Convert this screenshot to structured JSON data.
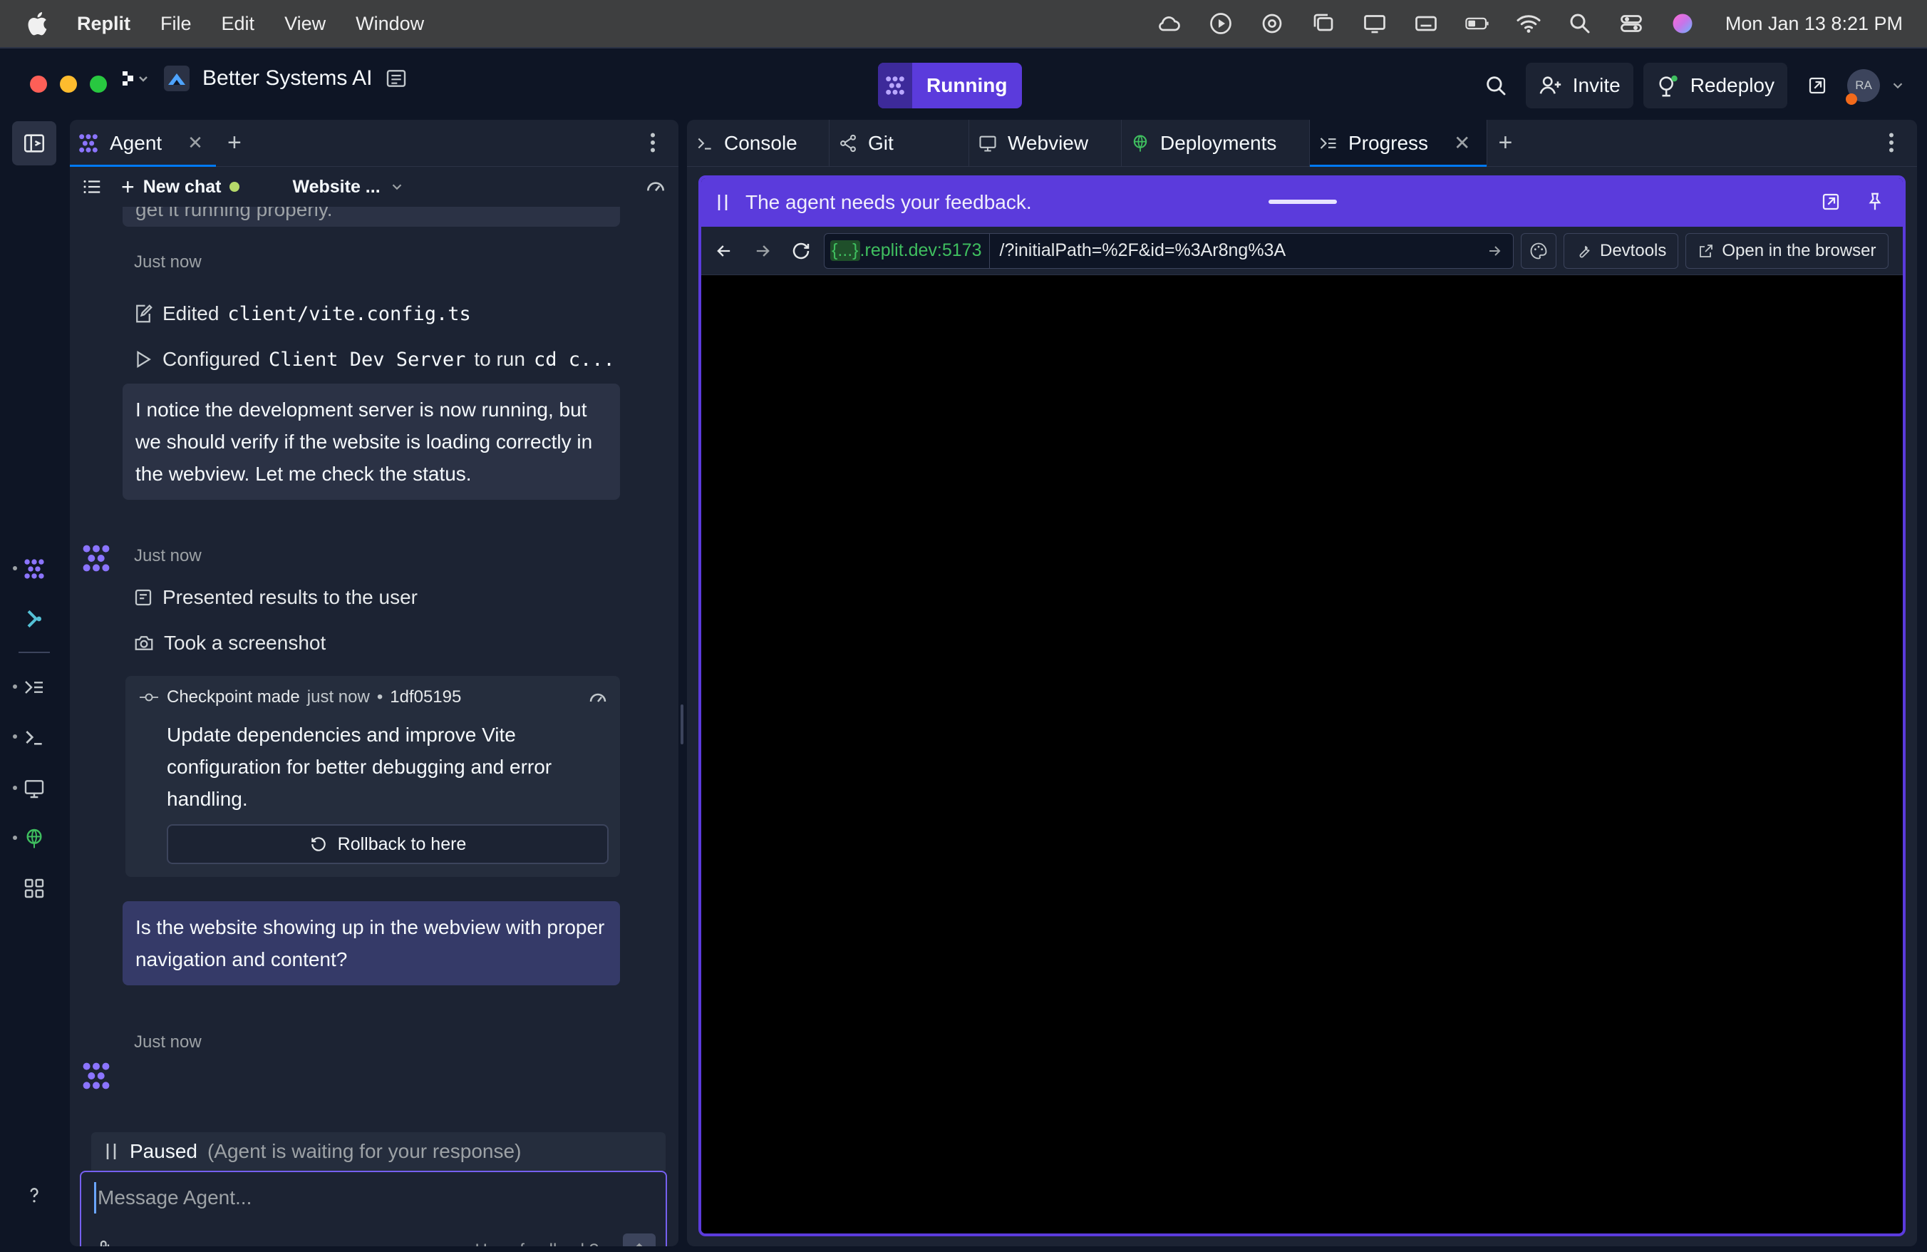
{
  "menubar": {
    "app_name": "Replit",
    "menus": [
      "File",
      "Edit",
      "View",
      "Window"
    ],
    "clock": "Mon Jan 13  8:21 PM"
  },
  "titlebar": {
    "project_name": "Better Systems AI",
    "run_status": "Running",
    "invite_label": "Invite",
    "redeploy_label": "Redeploy",
    "avatar_initials": "RA"
  },
  "left_tabs": {
    "agent_tab": "Agent",
    "new_chat": "New chat",
    "chat_title": "Website ..."
  },
  "chat": {
    "cut_text": "get it running properly.",
    "stamp1": "Just now",
    "edited_label": "Edited",
    "edited_file": "client/vite.config.ts",
    "configured_label": "Configured",
    "configured_name": "Client Dev Server",
    "configured_rest": "to run",
    "configured_cmd": "cd c...",
    "agent_msg": "I notice the development server is now running, but we should verify if the website is loading correctly in the webview. Let me check the status.",
    "stamp2": "Just now",
    "action_presented": "Presented results to the user",
    "action_screenshot": "Took a screenshot",
    "checkpoint_label": "Checkpoint made",
    "checkpoint_when": "just now",
    "checkpoint_sep": "•",
    "checkpoint_hash": "1df05195",
    "checkpoint_text": "Update dependencies and improve Vite configuration for better debugging and error handling.",
    "rollback_label": "Rollback to here",
    "agent_question": "Is the website showing up in the webview with proper navigation and content?",
    "stamp3": "Just now",
    "paused_label": "Paused",
    "paused_sub": "(Agent is waiting for your response)",
    "input_placeholder": "Message Agent...",
    "feedback_label": "Have feedback?"
  },
  "right_tabs": {
    "console": "Console",
    "git": "Git",
    "webview": "Webview",
    "deployments": "Deployments",
    "progress": "Progress"
  },
  "webview": {
    "banner": "The agent needs your feedback.",
    "url_host_brace": "{...}",
    "url_host": ".replit.dev:5173",
    "url_path": "/?initialPath=%2F&id=%3Ar8ng%3A",
    "devtools_label": "Devtools",
    "open_browser_label": "Open in the browser"
  },
  "colors": {
    "accent": "#5b3bdc",
    "background": "#0e1525",
    "panel": "#1c2333",
    "status_green": "#b5d96a"
  }
}
